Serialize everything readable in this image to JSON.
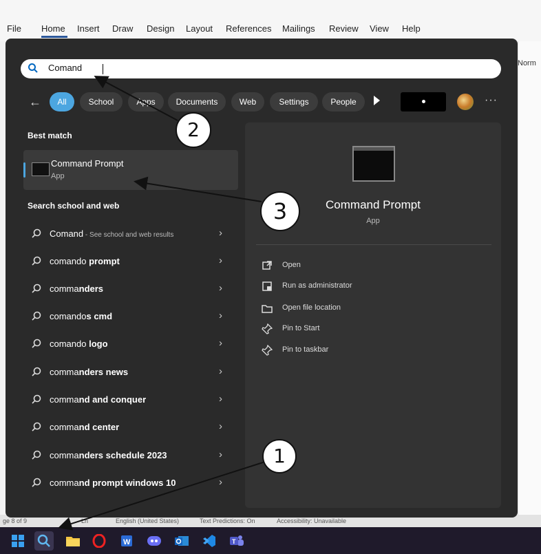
{
  "word": {
    "ribbon_tabs": [
      "File",
      "Home",
      "Insert",
      "Draw",
      "Design",
      "Layout",
      "References",
      "Mailings",
      "Review",
      "View",
      "Help"
    ],
    "style_label": "Norm",
    "status_items": [
      "ge 8 of 9",
      "Ln",
      "English (United States)",
      "Text Predictions: On",
      "Accessibility: Unavailable"
    ]
  },
  "search": {
    "value": "Comand",
    "placeholder": ""
  },
  "filters": [
    "All",
    "School",
    "Apps",
    "Documents",
    "Web",
    "Settings",
    "People"
  ],
  "best_match": {
    "heading": "Best match",
    "title": "Command Prompt",
    "subtitle": "App"
  },
  "web_section": {
    "heading": "Search school and web",
    "items": [
      {
        "bold": "",
        "light": "Comand",
        "hint": " - See school and web results"
      },
      {
        "light": "comando ",
        "bold": "prompt",
        "hint": ""
      },
      {
        "light": "comma",
        "bold": "nders",
        "hint": ""
      },
      {
        "light": "comando",
        "bold": "s cmd",
        "hint": ""
      },
      {
        "light": "comando ",
        "bold": "logo",
        "hint": ""
      },
      {
        "light": "comma",
        "bold": "nders news",
        "hint": ""
      },
      {
        "light": "comma",
        "bold": "nd and conquer",
        "hint": ""
      },
      {
        "light": "comma",
        "bold": "nd center",
        "hint": ""
      },
      {
        "light": "comma",
        "bold": "nders schedule 2023",
        "hint": ""
      },
      {
        "light": "comma",
        "bold": "nd prompt windows 10",
        "hint": ""
      }
    ]
  },
  "detail": {
    "title": "Command Prompt",
    "subtitle": "App",
    "actions": [
      "Open",
      "Run as administrator",
      "Open file location",
      "Pin to Start",
      "Pin to taskbar"
    ]
  },
  "callouts": [
    "1",
    "2",
    "3"
  ],
  "colors": {
    "accent": "#4ca6e0",
    "panel": "#2a2a2a",
    "pane": "#333333",
    "taskbar": "#1f1a2b"
  },
  "taskbar_icons": [
    "windows-start-icon",
    "search-icon",
    "file-explorer-icon",
    "opera-icon",
    "word-icon",
    "discord-icon",
    "outlook-icon",
    "vscode-icon",
    "teams-icon"
  ]
}
